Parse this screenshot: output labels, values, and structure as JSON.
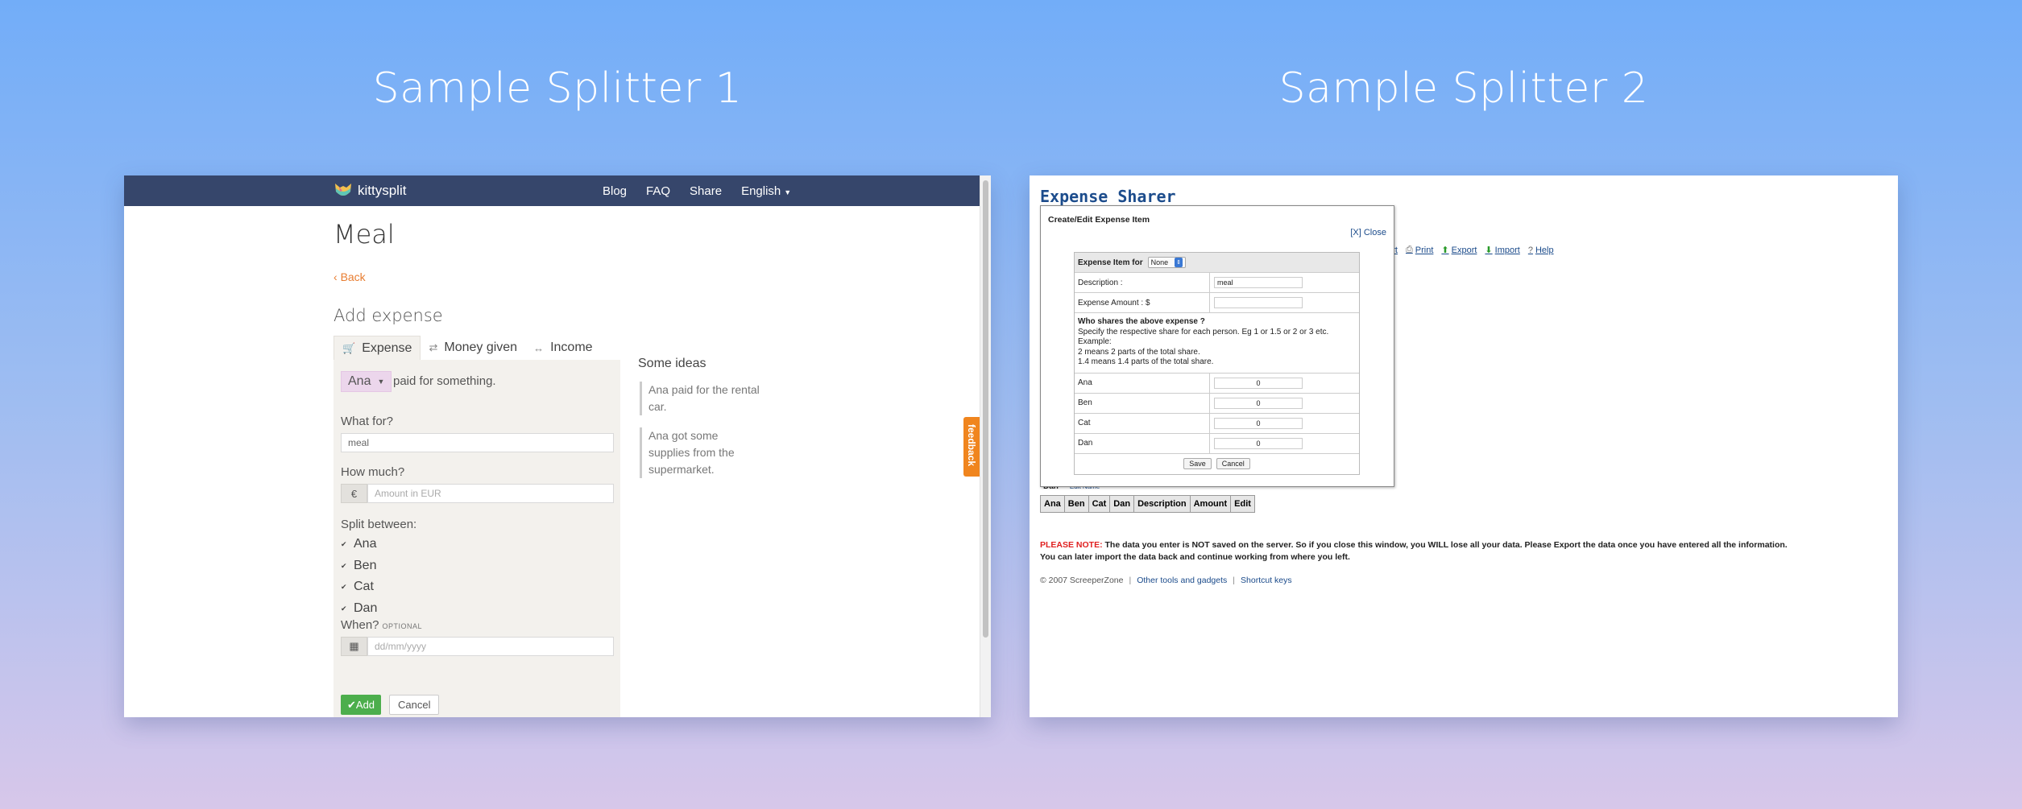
{
  "headings": {
    "left": "Sample Splitter 1",
    "right": "Sample Splitter 2"
  },
  "kittysplit": {
    "brand": "kittysplit",
    "nav": [
      "Blog",
      "FAQ",
      "Share"
    ],
    "language": "English",
    "title": "Meal",
    "back": "Back",
    "subtitle": "Add expense",
    "tabs": [
      "Expense",
      "Money given",
      "Income"
    ],
    "payer": "Ana",
    "paid_text": "paid for something.",
    "what_for_label": "What for?",
    "what_for_value": "meal",
    "how_much_label": "How much?",
    "currency_symbol": "€",
    "amount_placeholder": "Amount in EUR",
    "split_label": "Split between:",
    "people": [
      "Ana",
      "Ben",
      "Cat",
      "Dan"
    ],
    "when_label": "When?",
    "optional": "OPTIONAL",
    "date_placeholder": "dd/mm/yyyy",
    "add_button": "Add",
    "cancel_button": "Cancel",
    "ideas_title": "Some ideas",
    "ideas": [
      "Ana paid for the rental car.",
      "Ana got some supplies from the supermarket."
    ],
    "feedback": "feedback",
    "colors": {
      "nav": "#36466b",
      "accent": "#e87d31",
      "add": "#4cae4c",
      "payer": "#ecd6ec"
    }
  },
  "expense_sharer": {
    "title": "Expense Sharer",
    "toolbar": [
      "port",
      "Print",
      "Export",
      "Import",
      "Help"
    ],
    "dialog_title": "Create/Edit Expense Item",
    "close": "[X] Close",
    "item_for_label": "Expense Item for",
    "item_for_value": "None",
    "description_label": "Description :",
    "description_value": "meal",
    "amount_label": "Expense Amount : $",
    "amount_value": "",
    "share_title": "Who shares the above expense ?",
    "share_lines": [
      "Specify the respective share for each person. Eg 1 or 1.5 or 2 or 3 etc.",
      "Example:",
      "2 means 2 parts of the total share.",
      "1.4 means 1.4 parts of the total share."
    ],
    "people": [
      {
        "name": "Ana",
        "share": "0"
      },
      {
        "name": "Ben",
        "share": "0"
      },
      {
        "name": "Cat",
        "share": "0"
      },
      {
        "name": "Dan",
        "share": "0"
      }
    ],
    "save": "Save",
    "cancel": "Cancel",
    "peek_name": "Dan",
    "peek_edit": "Edit Name",
    "table_headers": [
      "Ana",
      "Ben",
      "Cat",
      "Dan",
      "Description",
      "Amount",
      "Edit"
    ],
    "note_label": "PLEASE NOTE:",
    "note_text": "The data you enter is NOT saved on the server. So if you close this window, you WILL lose all your data. Please Export the data once you have entered all the information.",
    "note_text2": "You can later import the data back and continue working from where you left.",
    "footer_copy": "© 2007 ScreeperZone",
    "footer_links": [
      "Other tools and gadgets",
      "Shortcut keys"
    ]
  }
}
